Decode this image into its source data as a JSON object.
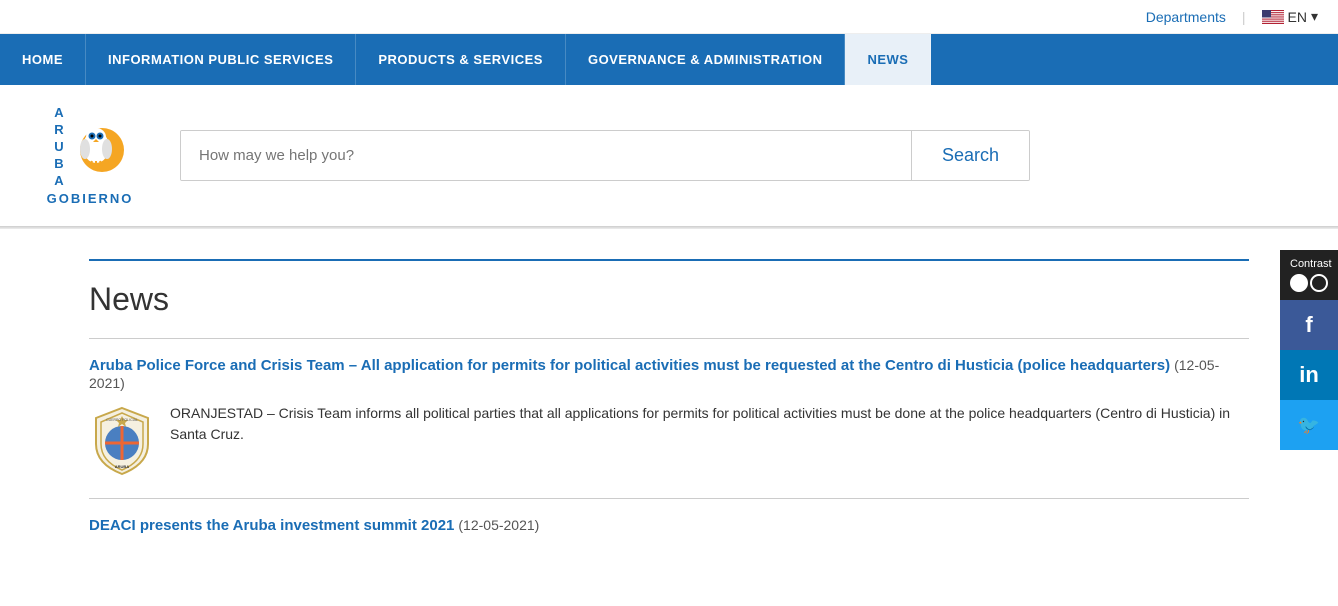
{
  "topbar": {
    "departments_label": "Departments",
    "lang_label": "EN"
  },
  "nav": {
    "items": [
      {
        "id": "home",
        "label": "HOME",
        "active": false
      },
      {
        "id": "information-public-services",
        "label": "INFORMATION PUBLIC SERVICES",
        "active": false
      },
      {
        "id": "products-services",
        "label": "PRODUCTS & SERVICES",
        "active": false
      },
      {
        "id": "governance-administration",
        "label": "GOVERNANCE & ADMINISTRATION",
        "active": false
      },
      {
        "id": "news",
        "label": "NEWS",
        "active": true
      }
    ]
  },
  "header": {
    "logo_text_a": "A",
    "logo_text_r": "R",
    "logo_text_u": "U",
    "logo_text_b": "B",
    "logo_text_a2": "A",
    "logo_gobierno": "GOBIERNO",
    "search_placeholder": "How may we help you?",
    "search_button_label": "Search"
  },
  "content": {
    "news_title": "News",
    "news_items": [
      {
        "id": "item1",
        "title": "Aruba Police Force and Crisis Team – All application for permits for political activities must be requested at the Centro di Husticia (police headquarters)",
        "date": "(12-05-2021)",
        "body": "ORANJESTAD – Crisis Team informs all political parties that all applications for permits for political activities must be done at the police headquarters (Centro di Husticia) in Santa Cruz."
      },
      {
        "id": "item2",
        "title": "DEACI presents the Aruba investment summit 2021",
        "date": "(12-05-2021)",
        "body": ""
      }
    ]
  },
  "sidebar": {
    "contrast_label": "Contrast",
    "facebook_label": "f",
    "linkedin_label": "in",
    "twitter_label": "🐦"
  }
}
